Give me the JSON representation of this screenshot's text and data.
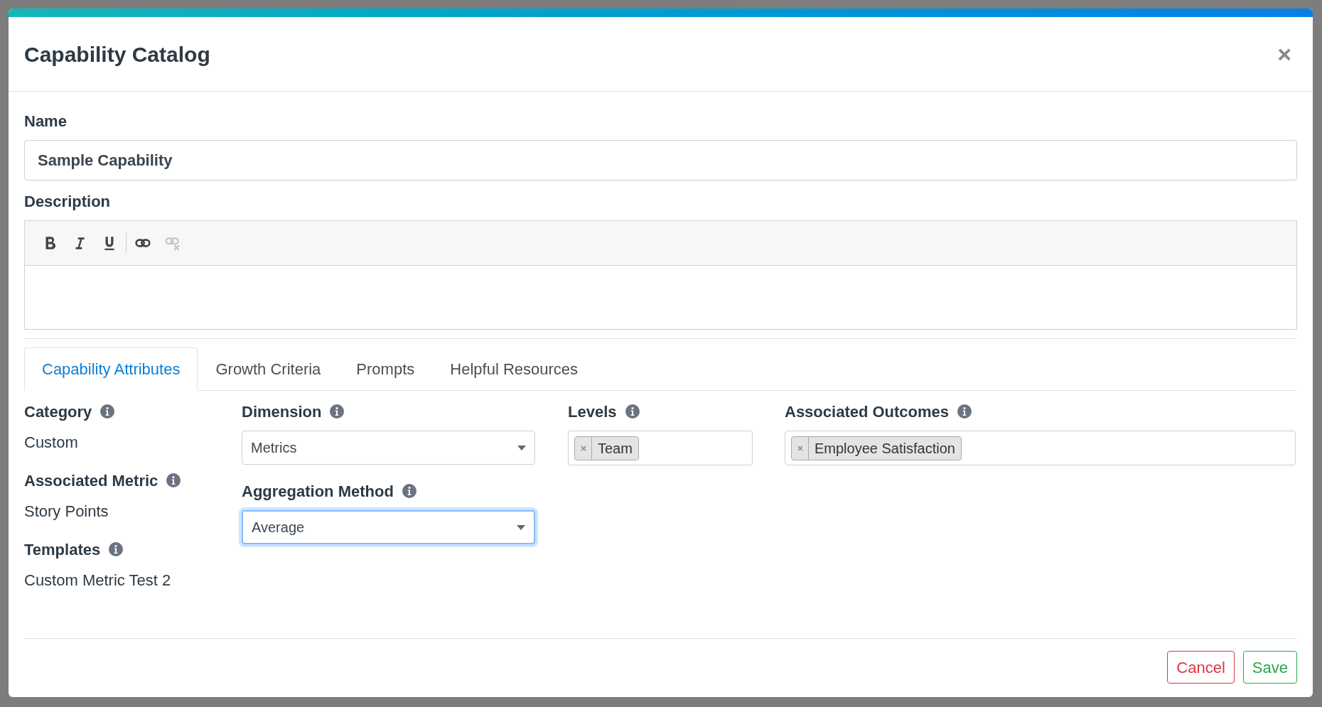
{
  "dialog": {
    "title": "Capability Catalog",
    "close": "×"
  },
  "name_field": {
    "label": "Name",
    "value": "Sample Capability"
  },
  "description": {
    "label": "Description",
    "toolbar": [
      {
        "kind": "bold",
        "disabled": false
      },
      {
        "kind": "italic",
        "disabled": false
      },
      {
        "kind": "underline",
        "disabled": false
      },
      {
        "kind": "link",
        "disabled": false
      },
      {
        "kind": "unlink",
        "disabled": true
      }
    ]
  },
  "tabs": [
    {
      "label": "Capability Attributes",
      "selected": true
    },
    {
      "label": "Growth Criteria",
      "selected": false
    },
    {
      "label": "Prompts",
      "selected": false
    },
    {
      "label": "Helpful Resources",
      "selected": false
    }
  ],
  "attributes": [
    {
      "kind": "text",
      "label": "Category",
      "value": "Custom"
    },
    {
      "kind": "select",
      "label": "Dimension",
      "value": "Metrics",
      "focused": false
    },
    {
      "kind": "tags",
      "label": "Levels",
      "tags": [
        "Team"
      ]
    },
    {
      "kind": "tags",
      "label": "Associated Outcomes",
      "tags": [
        "Employee Satisfaction"
      ]
    },
    {
      "kind": "text",
      "label": "Associated Metric",
      "value": "Story Points"
    },
    {
      "kind": "select",
      "label": "Aggregation Method",
      "value": "Average",
      "focused": true
    },
    {
      "kind": "text",
      "label": "Templates",
      "value": "Custom Metric Test 2"
    }
  ],
  "buttons": [
    {
      "kind": "cancel",
      "label": "Cancel"
    },
    {
      "kind": "save",
      "label": "Save"
    }
  ]
}
